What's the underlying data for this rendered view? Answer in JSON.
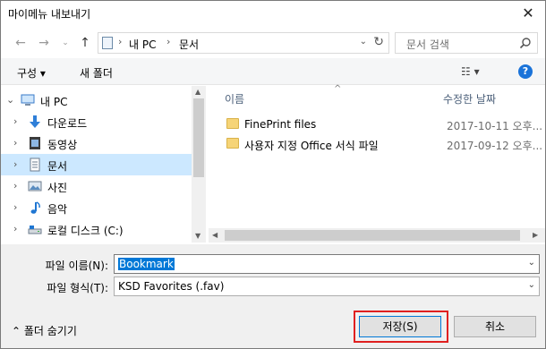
{
  "window": {
    "title": "마이메뉴 내보내기"
  },
  "address": {
    "segments": [
      "내 PC",
      "문서"
    ],
    "search_placeholder": "문서 검색"
  },
  "toolbar": {
    "organize": "구성 ▾",
    "new_folder": "새 폴더"
  },
  "nav": {
    "items": [
      {
        "label": "내 PC",
        "icon": "computer-icon"
      },
      {
        "label": "다운로드",
        "icon": "download-arrow-icon"
      },
      {
        "label": "동영상",
        "icon": "video-icon"
      },
      {
        "label": "문서",
        "icon": "document-icon",
        "selected": true
      },
      {
        "label": "사진",
        "icon": "picture-icon"
      },
      {
        "label": "음악",
        "icon": "music-note-icon"
      },
      {
        "label": "로컬 디스크 (C:)",
        "icon": "disk-icon"
      }
    ]
  },
  "files": {
    "columns": {
      "name": "이름",
      "modified": "수정한 날짜"
    },
    "rows": [
      {
        "name": "FinePrint files",
        "date": "2017-10-11 오후..."
      },
      {
        "name": "사용자 지정 Office 서식 파일",
        "date": "2017-09-12 오후..."
      }
    ]
  },
  "form": {
    "filename_label": "파일 이름(N):",
    "filename_value": "Bookmark",
    "filetype_label": "파일 형식(T):",
    "filetype_value": "KSD Favorites (.fav)"
  },
  "footer": {
    "hide_folders": "폴더 숨기기",
    "save": "저장(S)",
    "cancel": "취소"
  }
}
